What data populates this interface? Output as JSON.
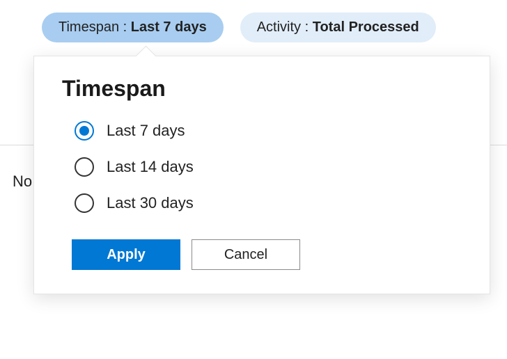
{
  "filters": {
    "timespan": {
      "label": "Timespan : ",
      "value": "Last 7 days"
    },
    "activity": {
      "label": "Activity : ",
      "value": "Total Processed"
    }
  },
  "background": {
    "truncated_text": "No"
  },
  "popover": {
    "title": "Timespan",
    "options": [
      {
        "label": "Last 7 days",
        "selected": true
      },
      {
        "label": "Last 14 days",
        "selected": false
      },
      {
        "label": "Last 30 days",
        "selected": false
      }
    ],
    "apply_label": "Apply",
    "cancel_label": "Cancel"
  }
}
